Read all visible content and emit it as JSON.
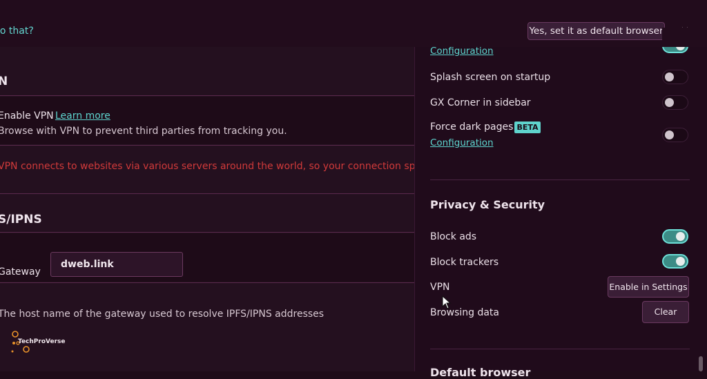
{
  "notification_bar": {
    "prompt": "lo that?",
    "default_button": "Yes, set it as default browser",
    "close": "×"
  },
  "settings": {
    "vpn": {
      "heading": "N",
      "enable_label": "Enable VPN",
      "learn_more": "Learn more",
      "description": "Browse with VPN to prevent third parties from tracking you.",
      "warning": "VPN connects to websites via various servers around the world, so your connection speed m"
    },
    "ipfs": {
      "heading": "S/IPNS",
      "gateway_label": "Gateway",
      "gateway_value": "dweb.link",
      "gateway_description": "The host name of the gateway used to resolve IPFS/IPNS addresses"
    }
  },
  "watermark": {
    "text": "TechProVerse"
  },
  "easy_setup": {
    "top_config_link": "Configuration",
    "splash_screen": {
      "label": "Splash screen on startup",
      "enabled": false
    },
    "gx_corner": {
      "label": "GX Corner in sidebar",
      "enabled": false
    },
    "force_dark": {
      "label": "Force dark pages",
      "badge": "BETA",
      "config_link": "Configuration",
      "enabled": false
    },
    "privacy": {
      "heading": "Privacy & Security",
      "block_ads": {
        "label": "Block ads",
        "enabled": true
      },
      "block_trackers": {
        "label": "Block trackers",
        "enabled": true
      },
      "vpn": {
        "label": "VPN",
        "button": "Enable in Settings"
      },
      "browsing_data": {
        "label": "Browsing data",
        "button": "Clear"
      }
    },
    "default_browser_heading": "Default browser"
  },
  "colors": {
    "accent_teal": "#5ed5cf",
    "warning_red": "#d13a3a",
    "background": "#1f0c19",
    "toggle_on": "#3c8c86"
  }
}
